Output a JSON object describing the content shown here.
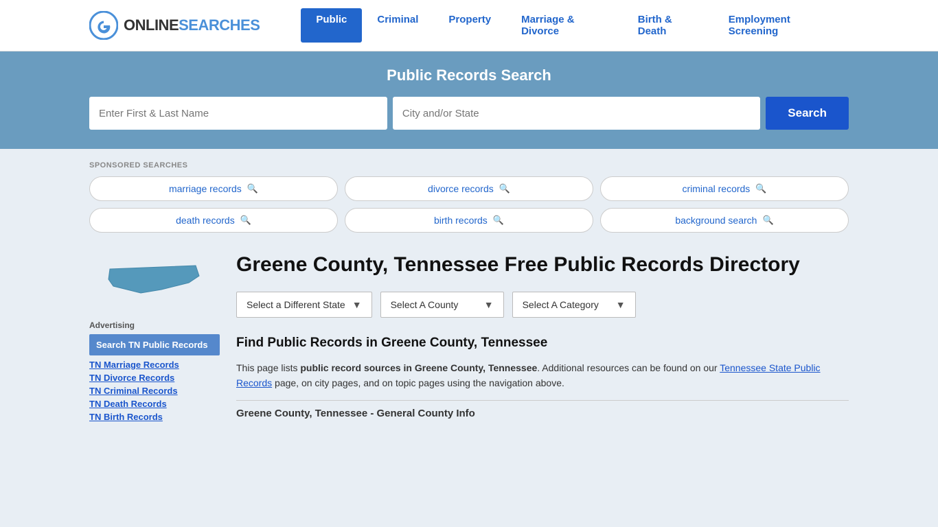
{
  "header": {
    "logo_text_online": "ONLINE",
    "logo_text_searches": "SEARCHES",
    "nav_items": [
      {
        "label": "Public",
        "active": true
      },
      {
        "label": "Criminal",
        "active": false
      },
      {
        "label": "Property",
        "active": false
      },
      {
        "label": "Marriage & Divorce",
        "active": false
      },
      {
        "label": "Birth & Death",
        "active": false
      },
      {
        "label": "Employment Screening",
        "active": false
      }
    ]
  },
  "hero": {
    "title": "Public Records Search",
    "name_placeholder": "Enter First & Last Name",
    "location_placeholder": "City and/or State",
    "search_label": "Search"
  },
  "sponsored": {
    "label": "SPONSORED SEARCHES",
    "tags": [
      {
        "text": "marriage records"
      },
      {
        "text": "divorce records"
      },
      {
        "text": "criminal records"
      },
      {
        "text": "death records"
      },
      {
        "text": "birth records"
      },
      {
        "text": "background search"
      }
    ]
  },
  "page": {
    "title": "Greene County, Tennessee Free Public Records Directory",
    "dropdown_state": "Select a Different State",
    "dropdown_county": "Select A County",
    "dropdown_category": "Select A Category",
    "section_heading": "Find Public Records in Greene County, Tennessee",
    "section_body_1": "This page lists ",
    "section_body_bold1": "public record sources in Greene County, Tennessee",
    "section_body_2": ". Additional resources can be found on our ",
    "section_body_link": "Tennessee State Public Records",
    "section_body_3": " page, on city pages, and on topic pages using the navigation above.",
    "county_info_heading": "Greene County, Tennessee - General County Info"
  },
  "sidebar": {
    "advertising_label": "Advertising",
    "ad_highlight": "Search TN Public Records",
    "links": [
      "TN Marriage Records",
      "TN Divorce Records",
      "TN Criminal Records",
      "TN Death Records",
      "TN Birth Records"
    ]
  }
}
